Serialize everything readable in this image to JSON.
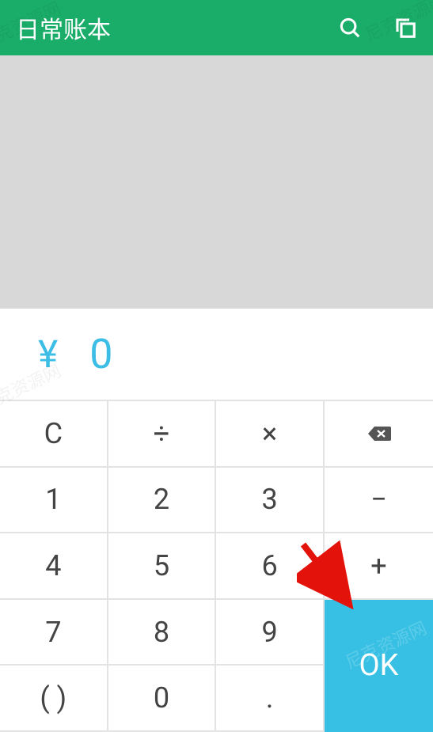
{
  "header": {
    "title": "日常账本"
  },
  "amount": {
    "currency": "¥",
    "value": "0"
  },
  "keys": {
    "clear": "C",
    "divide": "÷",
    "multiply": "×",
    "minus": "−",
    "plus": "+",
    "ok": "OK",
    "dot": ".",
    "paren": "( )",
    "n0": "0",
    "n1": "1",
    "n2": "2",
    "n3": "3",
    "n4": "4",
    "n5": "5",
    "n6": "6",
    "n7": "7",
    "n8": "8",
    "n9": "9"
  },
  "watermark": "尼克资源网"
}
